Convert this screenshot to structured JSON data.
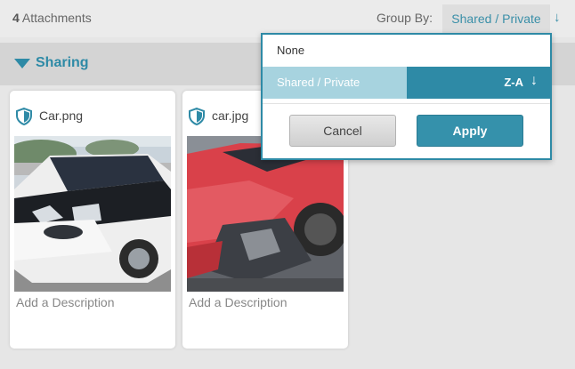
{
  "header": {
    "attachment_count": "4",
    "attachment_label": "Attachments",
    "group_by_label": "Group By:",
    "group_by_value": "Shared / Private",
    "sort_icon": "arrow-down-icon"
  },
  "section": {
    "title": "Sharing",
    "icon": "caret-down-icon"
  },
  "cards": [
    {
      "filename": "Car.png",
      "icon": "shield-icon",
      "image": "white-bmw-i3-photo",
      "description_placeholder": "Add a Description"
    },
    {
      "filename": "car.jpg",
      "icon": "shield-icon",
      "image": "wrecked-red-car-photo",
      "description_placeholder": "Add a Description"
    }
  ],
  "group_popup": {
    "options": [
      {
        "label": "None"
      },
      {
        "label": "Shared / Private",
        "selected": true
      }
    ],
    "sort_label": "Z-A",
    "sort_icon": "arrow-down-icon",
    "cancel_label": "Cancel",
    "apply_label": "Apply"
  },
  "colors": {
    "accent": "#2e8aa6",
    "selected_option_bg": "#a7d3df",
    "background": "#e6e6e6"
  }
}
